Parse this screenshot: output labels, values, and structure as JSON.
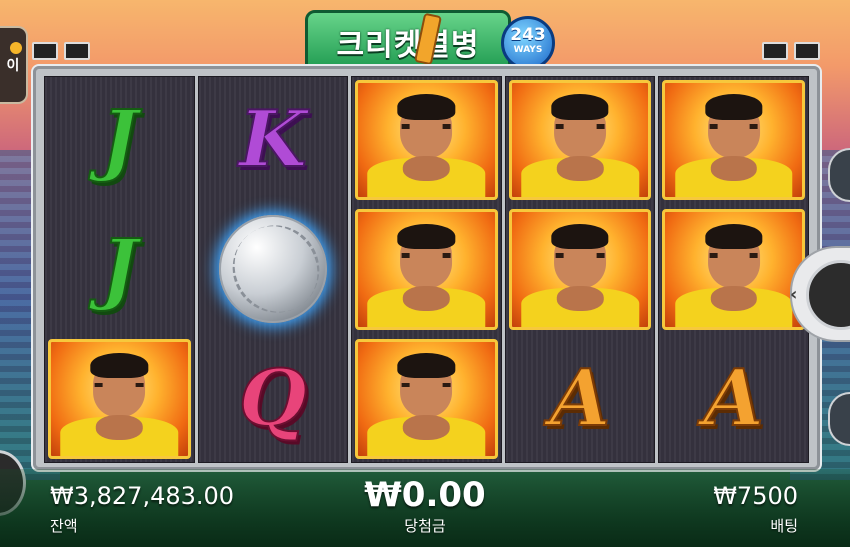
{
  "game": {
    "title": "크리켓열병",
    "ways_number": "243",
    "ways_label": "WAYS",
    "menu_label": "이"
  },
  "reels": [
    [
      "J",
      "J",
      "hero"
    ],
    [
      "K",
      "cricket-ball",
      "Q"
    ],
    [
      "hero",
      "hero",
      "hero"
    ],
    [
      "hero",
      "hero",
      "A"
    ],
    [
      "hero",
      "hero",
      "A"
    ]
  ],
  "footer": {
    "balance_value": "₩3,827,483.00",
    "balance_label": "잔액",
    "win_value": "₩0.00",
    "win_label": "당첨금",
    "bet_value": "₩7500",
    "bet_label": "배팅"
  },
  "colors": {
    "title_green": "#1e9a4f",
    "symbol_J": "#3cc23a",
    "symbol_K": "#b04bd6",
    "symbol_Q": "#e8447a",
    "symbol_A": "#f4a230",
    "hero_bg": "#ffb22e"
  }
}
